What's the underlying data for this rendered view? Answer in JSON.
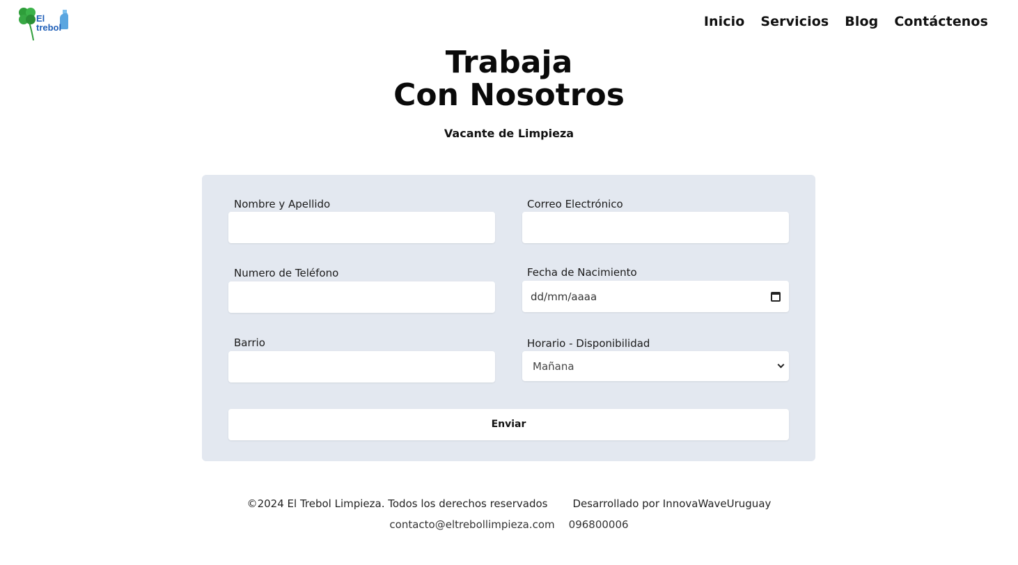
{
  "header": {
    "logo_text_line1": "El",
    "logo_text_line2": "trebol",
    "nav": [
      "Inicio",
      "Servicios",
      "Blog",
      "Contáctenos"
    ]
  },
  "hero": {
    "title_line1": "Trabaja",
    "title_line2": "Con Nosotros",
    "subtitle": "Vacante de Limpieza"
  },
  "form": {
    "name_label": "Nombre y Apellido",
    "name_value": "",
    "email_label": "Correo Electrónico",
    "email_value": "",
    "phone_label": "Numero de Teléfono",
    "phone_value": "",
    "birth_label": "Fecha de Nacimiento",
    "birth_placeholder": "dd/mm/aaaa",
    "neighborhood_label": "Barrio",
    "neighborhood_value": "",
    "schedule_label": "Horario - Disponibilidad",
    "schedule_selected": "Mañana",
    "submit_label": "Enviar"
  },
  "footer": {
    "copyright": "©2024 El Trebol Limpieza. Todos los derechos reservados",
    "developer": "Desarrollado por InnovaWaveUruguay",
    "email": "contacto@eltrebollimpieza.com",
    "phone": "096800006"
  },
  "colors": {
    "card_background": "#e3e8f0",
    "logo_green": "#2e9e3a",
    "logo_blue": "#1f5fb8"
  }
}
